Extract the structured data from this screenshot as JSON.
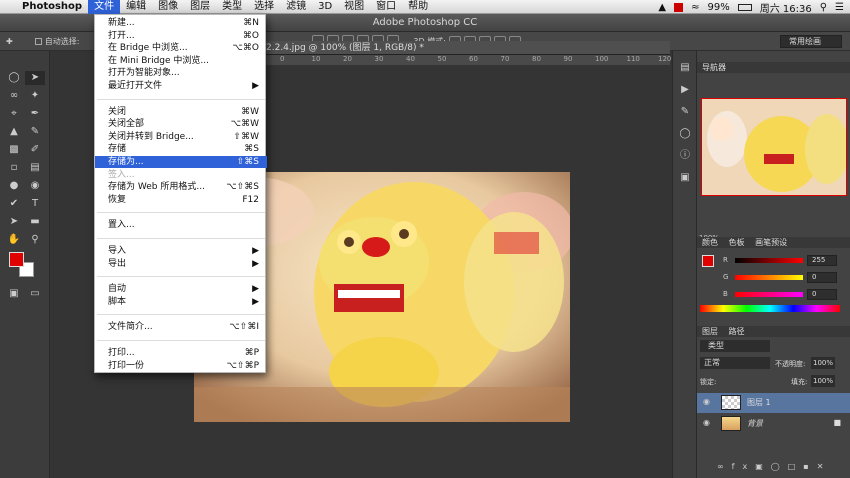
{
  "menubar": {
    "apple": "",
    "app": "Photoshop",
    "items": [
      "文件",
      "编辑",
      "图像",
      "图层",
      "类型",
      "选择",
      "滤镜",
      "3D",
      "视图",
      "窗口",
      "帮助"
    ],
    "active_index": 0,
    "right": {
      "battery": "99%",
      "clock": "周六 16:36"
    }
  },
  "window_title": "Adobe Photoshop CC",
  "options_bar": {
    "auto_select": "自动选择:",
    "mode_3d": "3D 模式:",
    "preset": "常用绘画"
  },
  "document": {
    "tab_title": "2.2.4.jpg @ 100% (图层 1, RGB/8) *",
    "ruler_ticks": [
      "0",
      "10",
      "20",
      "30",
      "40",
      "50",
      "60",
      "70",
      "80",
      "90",
      "100",
      "110",
      "120"
    ]
  },
  "file_menu": {
    "groups": [
      [
        {
          "label": "新建...",
          "shortcut": "⌘N"
        },
        {
          "label": "打开...",
          "shortcut": "⌘O"
        },
        {
          "label": "在 Bridge 中浏览...",
          "shortcut": "⌥⌘O"
        },
        {
          "label": "在 Mini Bridge 中浏览...",
          "shortcut": ""
        },
        {
          "label": "打开为智能对象...",
          "shortcut": ""
        },
        {
          "label": "最近打开文件",
          "shortcut": "▶"
        }
      ],
      [
        {
          "label": "关闭",
          "shortcut": "⌘W"
        },
        {
          "label": "关闭全部",
          "shortcut": "⌥⌘W"
        },
        {
          "label": "关闭并转到 Bridge...",
          "shortcut": "⇧⌘W"
        },
        {
          "label": "存储",
          "shortcut": "⌘S"
        },
        {
          "label": "存储为...",
          "shortcut": "⇧⌘S"
        },
        {
          "label": "签入...",
          "shortcut": ""
        },
        {
          "label": "存储为 Web 所用格式...",
          "shortcut": "⌥⇧⌘S"
        },
        {
          "label": "恢复",
          "shortcut": "F12"
        }
      ],
      [
        {
          "label": "置入...",
          "shortcut": ""
        }
      ],
      [
        {
          "label": "导入",
          "shortcut": "▶"
        },
        {
          "label": "导出",
          "shortcut": "▶"
        }
      ],
      [
        {
          "label": "自动",
          "shortcut": "▶"
        },
        {
          "label": "脚本",
          "shortcut": "▶"
        }
      ],
      [
        {
          "label": "文件简介...",
          "shortcut": "⌥⇧⌘I"
        }
      ],
      [
        {
          "label": "打印...",
          "shortcut": "⌘P"
        },
        {
          "label": "打印一份",
          "shortcut": "⌥⇧⌘P"
        }
      ]
    ],
    "highlighted": "存储为...",
    "disabled": "签入..."
  },
  "panels": {
    "navigator": {
      "tab": "导航器",
      "zoom": "100%"
    },
    "color": {
      "tabs": [
        "颜色",
        "色板",
        "画笔预设"
      ],
      "r": "255",
      "g": "0",
      "b": "0"
    },
    "layers": {
      "tabs": [
        "图层",
        "路径"
      ],
      "filter": "类型",
      "blend": "正常",
      "opacity_label": "不透明度:",
      "opacity": "100%",
      "lock_label": "锁定:",
      "fill_label": "填充:",
      "fill": "100%",
      "items": [
        {
          "name": "图层 1",
          "selected": true
        },
        {
          "name": "背景",
          "selected": false
        }
      ]
    }
  },
  "colors": {
    "accent": "#2f62d8",
    "foreground": "#e00000",
    "background": "#ffffff"
  }
}
